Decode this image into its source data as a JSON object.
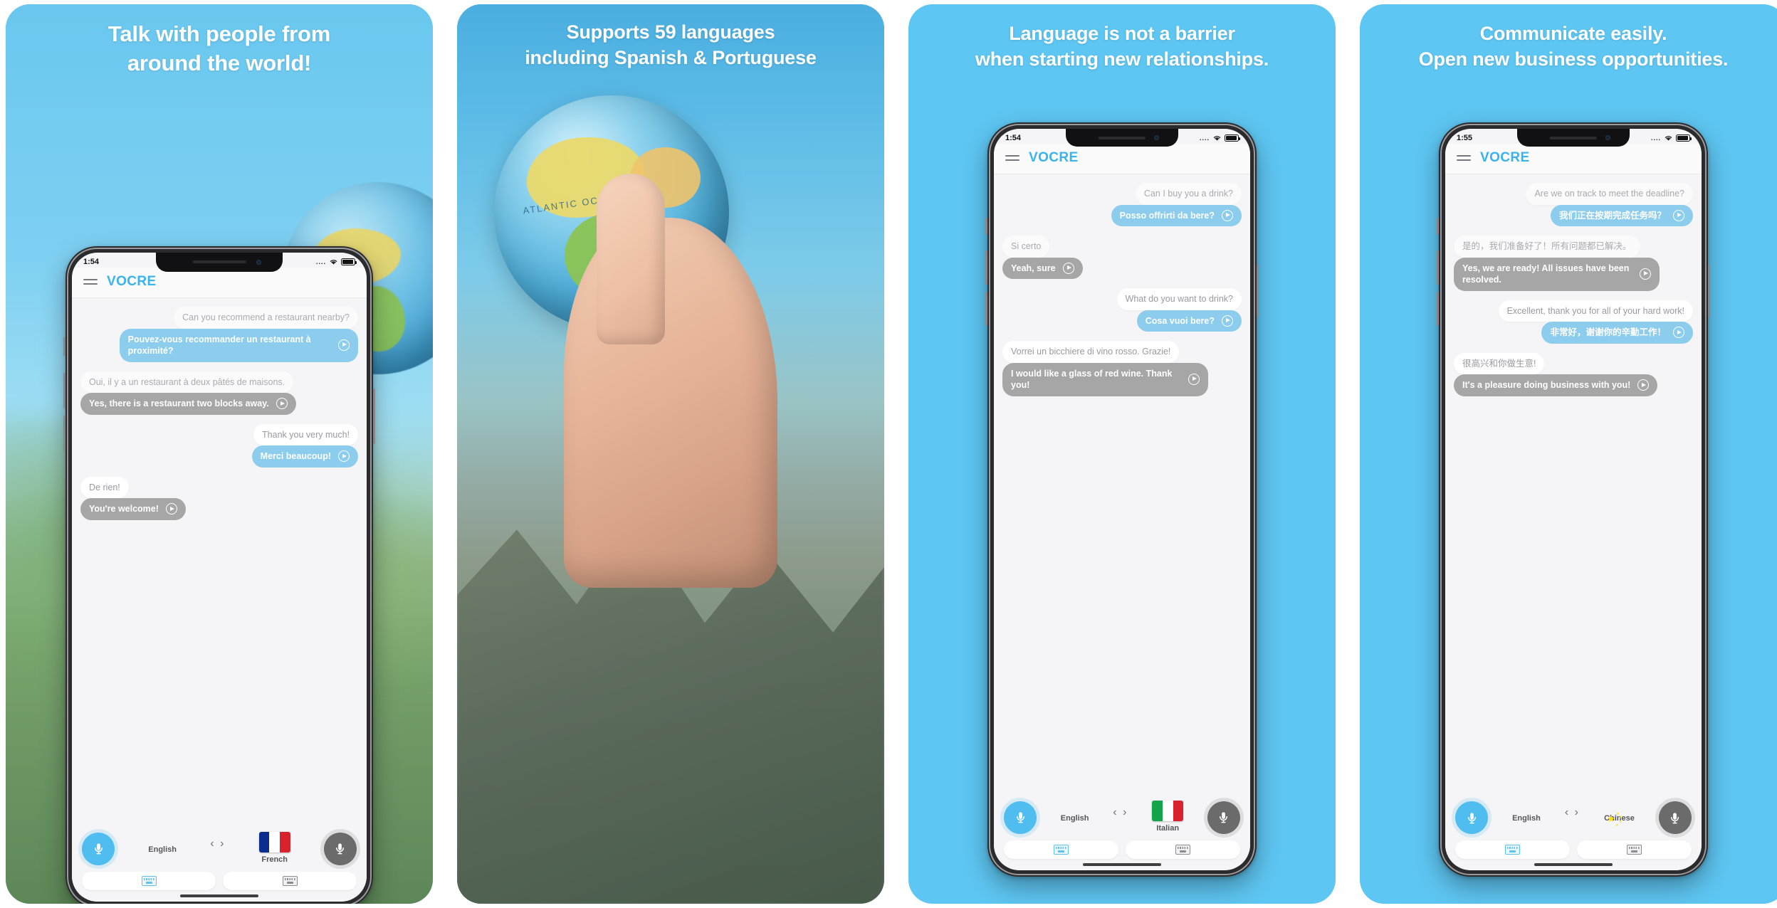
{
  "brand": "VOCRE",
  "colors": {
    "panel_bg": "#5ec6f2",
    "brand_blue": "#39b3ef",
    "bubble_translated": "#8ccdee",
    "bubble_reply": "#a6a6a6",
    "mic_active": "#4fbdef",
    "mic_inactive": "#6b6b6b"
  },
  "panels": [
    {
      "headline": "Talk with people from\naround the world!",
      "headline_line1": "Talk with people from",
      "headline_line2": "around the world!",
      "status": {
        "time": "1:54",
        "signal": "....",
        "wifi": "wifi-icon",
        "battery": "battery-icon"
      },
      "messages": [
        {
          "side": "right",
          "source": "Can you recommend a restaurant nearby?",
          "translation": "Pouvez-vous recommander un restaurant à proximité?",
          "style": "blue"
        },
        {
          "side": "left",
          "source": "Oui, il y a un restaurant à deux pâtés de maisons.",
          "translation": "Yes, there is a restaurant two blocks away.",
          "style": "gray"
        },
        {
          "side": "right",
          "source": "Thank you very much!",
          "translation": "Merci beaucoup!",
          "style": "blue"
        },
        {
          "side": "left",
          "source": "De rien!",
          "translation": "You're welcome!",
          "style": "gray"
        }
      ],
      "toolbar": {
        "mic_left": "microphone-icon",
        "mic_right": "microphone-icon",
        "lang_left": "English",
        "lang_right": "French",
        "flag_left": "flag-us",
        "flag_right": "flag-fr",
        "swap": "‹ ›",
        "keyboard_left": "keyboard-icon",
        "keyboard_right": "keyboard-icon"
      }
    },
    {
      "headline_line1": "Supports 59 languages",
      "headline_line2": "including Spanish & Portuguese",
      "globe_label": "ATLANTIC OCEAN"
    },
    {
      "headline_line1": "Language is not a barrier",
      "headline_line2": "when starting new relationships.",
      "status": {
        "time": "1:54",
        "signal": "....",
        "wifi": "wifi-icon",
        "battery": "battery-icon"
      },
      "messages": [
        {
          "side": "right",
          "source": "Can I buy you a drink?",
          "translation": "Posso offrirti da bere?",
          "style": "blue"
        },
        {
          "side": "left",
          "source": "Si certo",
          "translation": "Yeah, sure",
          "style": "gray"
        },
        {
          "side": "right",
          "source": "What do you want to drink?",
          "translation": "Cosa vuoi bere?",
          "style": "blue"
        },
        {
          "side": "left",
          "source": "Vorrei un bicchiere di vino rosso. Grazie!",
          "translation": "I would like a glass of red wine. Thank you!",
          "style": "gray"
        }
      ],
      "toolbar": {
        "mic_left": "microphone-icon",
        "mic_right": "microphone-icon",
        "lang_left": "English",
        "lang_right": "Italian",
        "flag_left": "flag-us",
        "flag_right": "flag-it",
        "swap": "‹ ›",
        "keyboard_left": "keyboard-icon",
        "keyboard_right": "keyboard-icon"
      }
    },
    {
      "headline_line1": "Communicate easily.",
      "headline_line2": "Open new business opportunities.",
      "status": {
        "time": "1:55",
        "signal": "....",
        "wifi": "wifi-icon",
        "battery": "battery-icon"
      },
      "messages": [
        {
          "side": "right",
          "source": "Are we on track to meet the deadline?",
          "translation": "我们正在按期完成任务吗？",
          "style": "blue"
        },
        {
          "side": "left",
          "source": "是的，我们准备好了！所有问题都已解决。",
          "translation": "Yes, we are ready! All issues have been resolved.",
          "style": "gray"
        },
        {
          "side": "right",
          "source": "Excellent, thank you for all of your hard work!",
          "translation": "非常好，谢谢你的辛勤工作！",
          "style": "blue"
        },
        {
          "side": "left",
          "source": "很高兴和你做生意!",
          "translation": "It's a pleasure doing business with you!",
          "style": "gray"
        }
      ],
      "toolbar": {
        "mic_left": "microphone-icon",
        "mic_right": "microphone-icon",
        "lang_left": "English",
        "lang_right": "Chinese",
        "flag_left": "flag-us",
        "flag_right": "flag-cn",
        "swap": "‹ ›",
        "keyboard_left": "keyboard-icon",
        "keyboard_right": "keyboard-icon"
      }
    }
  ]
}
